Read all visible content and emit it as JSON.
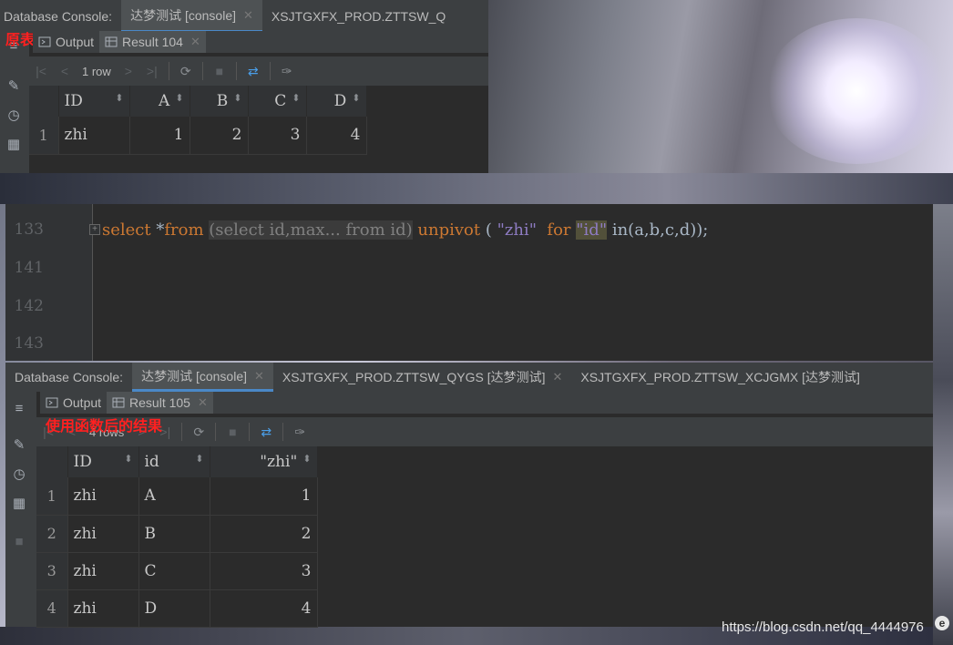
{
  "top_console": {
    "tabs": [
      {
        "label": "Database Console:"
      },
      {
        "label": "达梦测试 [console]"
      },
      {
        "label": "XSJTGXFX_PROD.ZTTSW_Q"
      }
    ],
    "annotation": "原表",
    "subtabs": {
      "output": "Output",
      "result": "Result 104"
    },
    "row_count": "1 row",
    "columns": [
      "ID",
      "A",
      "B",
      "C",
      "D"
    ],
    "rows": [
      {
        "num": "1",
        "ID": "zhi",
        "A": "1",
        "B": "2",
        "C": "3",
        "D": "4"
      }
    ]
  },
  "editor": {
    "line_numbers": [
      "133",
      "141",
      "142",
      "143"
    ],
    "line133": {
      "kw_select": "select",
      "star": " *",
      "kw_from": "from",
      "space1": " ",
      "folded": "(select id,max... from id)",
      "kw_unpivot": " unpivot",
      "paren_open": " ( ",
      "str_zhi": "\"zhi\"",
      "kw_for": "  for ",
      "str_id": "\"id\"",
      "in_clause": " in(a,b,c,d));"
    }
  },
  "bottom_console": {
    "tabs": [
      {
        "label": "Database Console:"
      },
      {
        "label": "达梦测试 [console]"
      },
      {
        "label": "XSJTGXFX_PROD.ZTTSW_QYGS [达梦测试]"
      },
      {
        "label": "XSJTGXFX_PROD.ZTTSW_XCJGMX [达梦测试]"
      }
    ],
    "annotation": "使用函数后的结果",
    "subtabs": {
      "output": "Output",
      "result": "Result 105"
    },
    "row_count": "4 rows",
    "columns": [
      "ID",
      "id",
      "\"zhi\""
    ],
    "rows": [
      {
        "num": "1",
        "ID": "zhi",
        "id": "A",
        "zhi": "1"
      },
      {
        "num": "2",
        "ID": "zhi",
        "id": "B",
        "zhi": "2"
      },
      {
        "num": "3",
        "ID": "zhi",
        "id": "C",
        "zhi": "3"
      },
      {
        "num": "4",
        "ID": "zhi",
        "id": "D",
        "zhi": "4"
      }
    ]
  },
  "watermark": "https://blog.csdn.net/qq_4444976"
}
